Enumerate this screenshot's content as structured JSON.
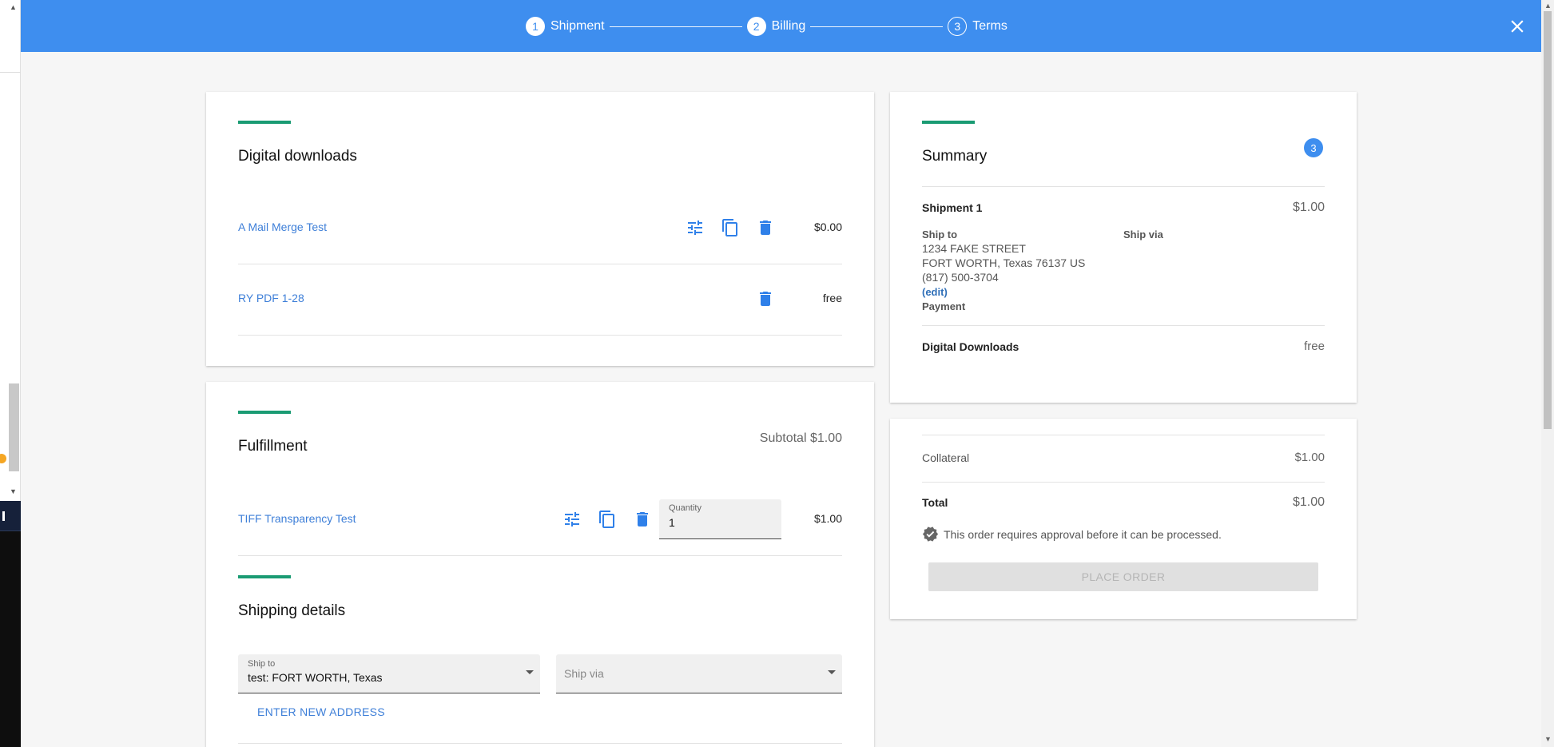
{
  "stepper": {
    "steps": [
      {
        "num": "1",
        "label": "Shipment"
      },
      {
        "num": "2",
        "label": "Billing"
      },
      {
        "num": "3",
        "label": "Terms"
      }
    ]
  },
  "digital_downloads": {
    "title": "Digital downloads",
    "items": [
      {
        "name": "A Mail Merge Test",
        "price": "$0.00"
      },
      {
        "name": "RY PDF 1-28",
        "price": "free"
      }
    ]
  },
  "fulfillment": {
    "title": "Fulfillment",
    "subtotal": "Subtotal $1.00",
    "items": [
      {
        "name": "TIFF Transparency Test",
        "quantity_label": "Quantity",
        "quantity": "1",
        "price": "$1.00"
      }
    ]
  },
  "shipping_details": {
    "title": "Shipping details",
    "ship_to_label": "Ship to",
    "ship_to_value": "test: FORT WORTH, Texas",
    "ship_via_placeholder": "Ship via",
    "enter_new_address": "ENTER NEW ADDRESS"
  },
  "summary": {
    "title": "Summary",
    "badge": "3",
    "shipment_label": "Shipment 1",
    "shipment_price": "$1.00",
    "ship_to_label": "Ship to",
    "ship_via_label": "Ship via",
    "address_line1": "1234 FAKE STREET",
    "address_line2": "FORT WORTH, Texas 76137 US",
    "phone": "(817) 500-3704",
    "edit_label": "(edit)",
    "payment_label": "Payment",
    "digital_downloads_label": "Digital Downloads",
    "digital_downloads_price": "free"
  },
  "totals": {
    "collateral_label": "Collateral",
    "collateral_price": "$1.00",
    "total_label": "Total",
    "total_price": "$1.00",
    "approval_note": "This order requires approval before it can be processed.",
    "place_order": "PLACE ORDER"
  },
  "colors": {
    "header": "#3e8eef",
    "accent": "#1a9b73",
    "link": "#3e7fd8"
  }
}
